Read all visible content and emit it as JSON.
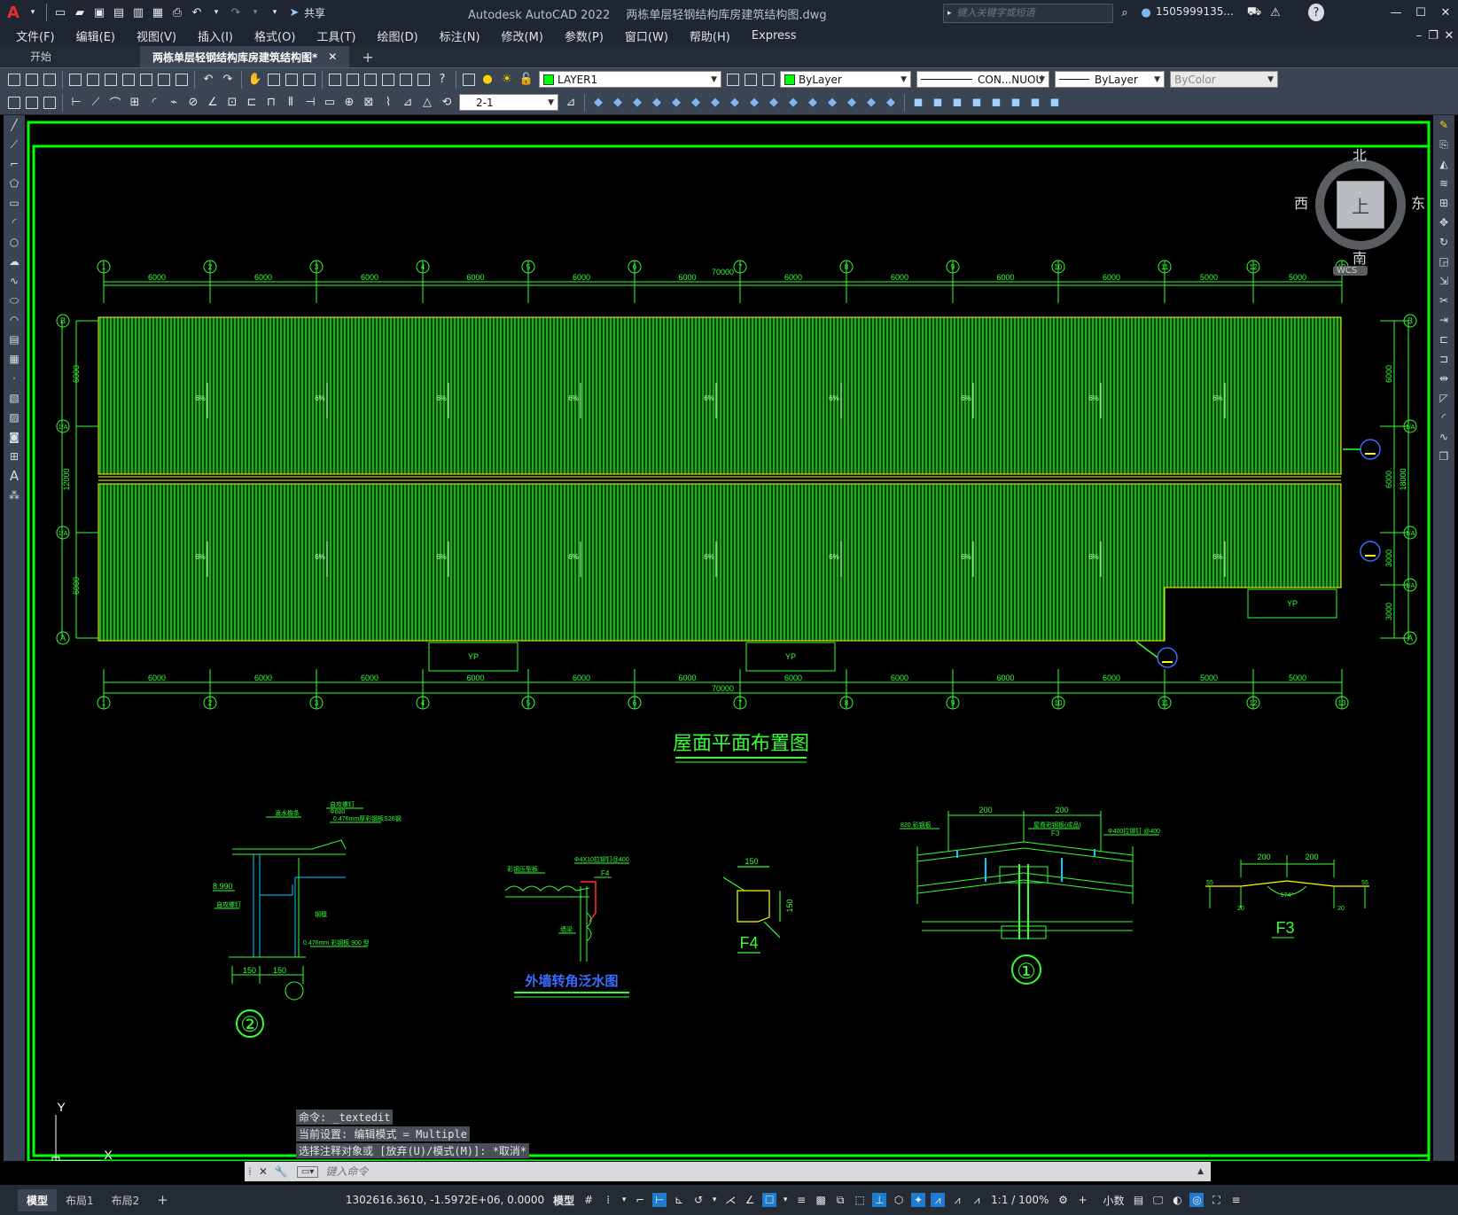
{
  "titlebar": {
    "app_name": "Autodesk AutoCAD 2022",
    "doc_name": "两栋单层轻钢结构库房建筑结构图.dwg",
    "share_label": "共享",
    "search_placeholder": "键入关键字或短语",
    "user": "1505999135..."
  },
  "menu": [
    "文件(F)",
    "编辑(E)",
    "视图(V)",
    "插入(I)",
    "格式(O)",
    "工具(T)",
    "绘图(D)",
    "标注(N)",
    "修改(M)",
    "参数(P)",
    "窗口(W)",
    "帮助(H)",
    "Express"
  ],
  "tabs": {
    "start": "开始",
    "doc": "两栋单层轻钢结构库房建筑结构图*"
  },
  "toolbar": {
    "layer_name": "LAYER1",
    "color": "ByLayer",
    "linetype": "CON...NUOU",
    "lineweight": "ByLayer",
    "plotstyle": "ByColor",
    "dim_style": "2-1"
  },
  "viewcube": {
    "north": "北",
    "south": "南",
    "east": "东",
    "west": "西",
    "top": "上",
    "wcs": "WCS"
  },
  "drawing": {
    "plan_title": "屋面平面布置图",
    "axes_numbers": [
      "1",
      "2",
      "3",
      "4",
      "5",
      "6",
      "7",
      "8",
      "9",
      "10",
      "11",
      "12",
      "13"
    ],
    "bay_spacings": [
      "6000",
      "6000",
      "6000",
      "6000",
      "6000",
      "6000",
      "6000",
      "6000",
      "6000",
      "6000",
      "5000",
      "5000"
    ],
    "total_length": "70000",
    "row_letters": [
      "B",
      "1/A",
      "1/A",
      "A"
    ],
    "left_dims": [
      "6000",
      "6000"
    ],
    "left_total": "12000",
    "right_dims": [
      "6000",
      "6000",
      "3000",
      "3000"
    ],
    "right_total": "18000",
    "slope_label": "6%",
    "yp_label": "YP",
    "detail2": {
      "labels": [
        "自攻螺钉",
        "Φ600",
        "0.476mm厚彩钢板S26钢",
        "滴水檐条",
        "8.990",
        "自攻螺钉",
        "钢檩",
        "0.476mm 彩钢板 900 型"
      ],
      "dims": [
        "150",
        "150"
      ],
      "mark": "②"
    },
    "corner_title": "外墙转角泛水图",
    "corner_labels": [
      "Φ4X10拉铆钉@400",
      "彩钢压型板",
      "F4",
      "墙梁"
    ],
    "f4": {
      "dim_top": "150",
      "dim_side": "150",
      "name": "F4"
    },
    "detail1": {
      "dims": [
        "200",
        "200"
      ],
      "labels": [
        "820 彩钢板",
        "屋脊彩钢板(成品)",
        "F3",
        "Φ400拉铆钉 @400"
      ],
      "mark": "①"
    },
    "f3": {
      "dims": [
        "200",
        "200",
        "20",
        "20",
        "174°",
        "55",
        "55"
      ],
      "name": "F3"
    }
  },
  "command": {
    "history": [
      "命令: _textedit",
      "当前设置: 编辑模式 = Multiple",
      "选择注释对象或 [放弃(U)/模式(M)]: *取消*"
    ],
    "placeholder": "键入命令"
  },
  "layout_tabs": [
    "模型",
    "布局1",
    "布局2"
  ],
  "status": {
    "coords": "1302616.3610, -1.5972E+06, 0.0000",
    "model": "模型",
    "scale": "1:1 / 100%",
    "units": "小数"
  }
}
